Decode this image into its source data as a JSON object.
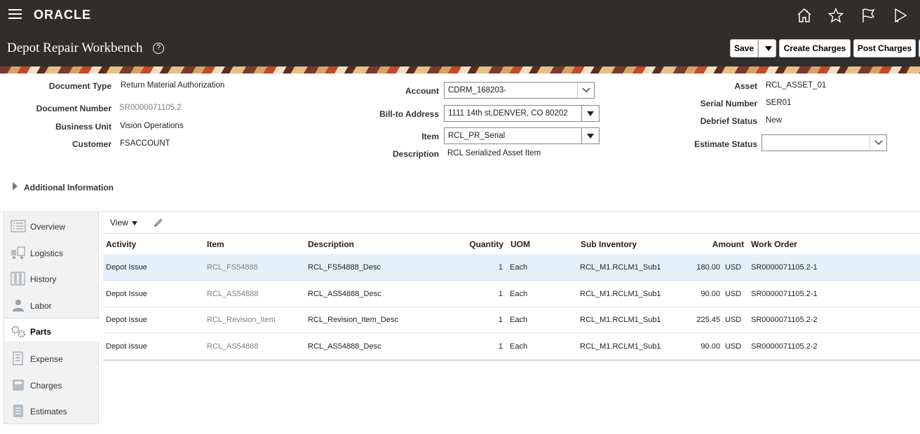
{
  "app": {
    "logo": "ORACLE",
    "page_title": "Depot Repair Workbench",
    "help": "?"
  },
  "icons": {
    "menu": "hamburger-icon",
    "home": "home-icon",
    "favorites": "star-icon",
    "watchlist": "flag-icon",
    "notifications": "notifications-icon"
  },
  "actions": {
    "save": "Save",
    "create_charges": "Create Charges",
    "post_charges": "Post Charges"
  },
  "header": {
    "document_type": {
      "label": "Document Type",
      "value": "Return Material Authorization"
    },
    "document_number": {
      "label": "Document Number",
      "value": "SR0000071105.2"
    },
    "business_unit": {
      "label": "Business Unit",
      "value": "Vision Operations"
    },
    "customer": {
      "label": "Customer",
      "value": "FSACCOUNT"
    },
    "account": {
      "label": "Account",
      "value": "CDRM_168203-"
    },
    "bill_to": {
      "label": "Bill-to Address",
      "value": "1111 14th st,DENVER, CO 80202"
    },
    "item": {
      "label": "Item",
      "value": "RCL_PR_Serial"
    },
    "description": {
      "label": "Description",
      "value": "RCL Serialized Asset Item"
    },
    "asset": {
      "label": "Asset",
      "value": "RCL_ASSET_01"
    },
    "serial_number": {
      "label": "Serial Number",
      "value": "SER01"
    },
    "debrief_status": {
      "label": "Debrief Status",
      "value": "New"
    },
    "estimate_status": {
      "label": "Estimate Status",
      "value": ""
    }
  },
  "additional_info": "Additional Information",
  "nav": {
    "items": [
      {
        "label": "Overview",
        "icon": "overview-icon"
      },
      {
        "label": "Logistics",
        "icon": "logistics-icon"
      },
      {
        "label": "History",
        "icon": "history-icon"
      },
      {
        "label": "Labor",
        "icon": "labor-icon"
      },
      {
        "label": "Parts",
        "icon": "parts-icon"
      },
      {
        "label": "Expense",
        "icon": "expense-icon"
      },
      {
        "label": "Charges",
        "icon": "charges-icon"
      },
      {
        "label": "Estimates",
        "icon": "estimates-icon"
      }
    ],
    "active": "Parts"
  },
  "table": {
    "view_label": "View",
    "columns": [
      "Activity",
      "Item",
      "Description",
      "Quantity",
      "UOM",
      "Sub Inventory",
      "Amount",
      "Work Order"
    ],
    "rows": [
      {
        "activity": "Depot Issue",
        "item": "RCL_FS54888",
        "description": "RCL_FS54888_Desc",
        "quantity": "1",
        "uom": "Each",
        "sub_inventory": "RCL_M1.RCLM1_Sub1",
        "amount": "180.00",
        "currency": "USD",
        "work_order": "SR0000071105.2-1"
      },
      {
        "activity": "Depot Issue",
        "item": "RCL_AS54888",
        "description": "RCL_AS54888_Desc",
        "quantity": "1",
        "uom": "Each",
        "sub_inventory": "RCL_M1.RCLM1_Sub1",
        "amount": "90.00",
        "currency": "USD",
        "work_order": "SR0000071105.2-1"
      },
      {
        "activity": "Depot Issue",
        "item": "RCL_Revision_Item",
        "description": "RCL_Revision_Item_Desc",
        "quantity": "1",
        "uom": "Each",
        "sub_inventory": "RCL_M1.RCLM1_Sub1",
        "amount": "225.45",
        "currency": "USD",
        "work_order": "SR0000071105.2-2"
      },
      {
        "activity": "Depot Issue",
        "item": "RCL_AS54888",
        "description": "RCL_AS54888_Desc",
        "quantity": "1",
        "uom": "Each",
        "sub_inventory": "RCL_M1.RCLM1_Sub1",
        "amount": "90.00",
        "currency": "USD",
        "work_order": "SR0000071105.2-2"
      }
    ]
  }
}
